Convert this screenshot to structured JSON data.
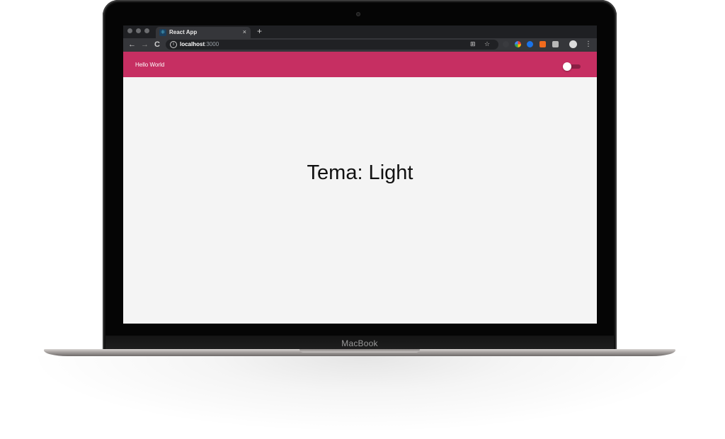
{
  "browser": {
    "tab_title": "React App",
    "tab_close": "×",
    "new_tab": "+",
    "url_host": "localhost",
    "url_port": ":3000",
    "nav": {
      "back": "←",
      "forward": "→",
      "reload": "C"
    }
  },
  "app": {
    "header_title": "Hello World",
    "theme_label": "Tema: Light",
    "theme_switch_checked": false,
    "accent_color": "#c62f62"
  },
  "device": {
    "brand": "MacBook"
  },
  "icons": {
    "favicon": "react-icon",
    "info": "info-icon",
    "translate": "translate-icon",
    "star": "star-icon",
    "menu": "kebab-menu-icon"
  }
}
